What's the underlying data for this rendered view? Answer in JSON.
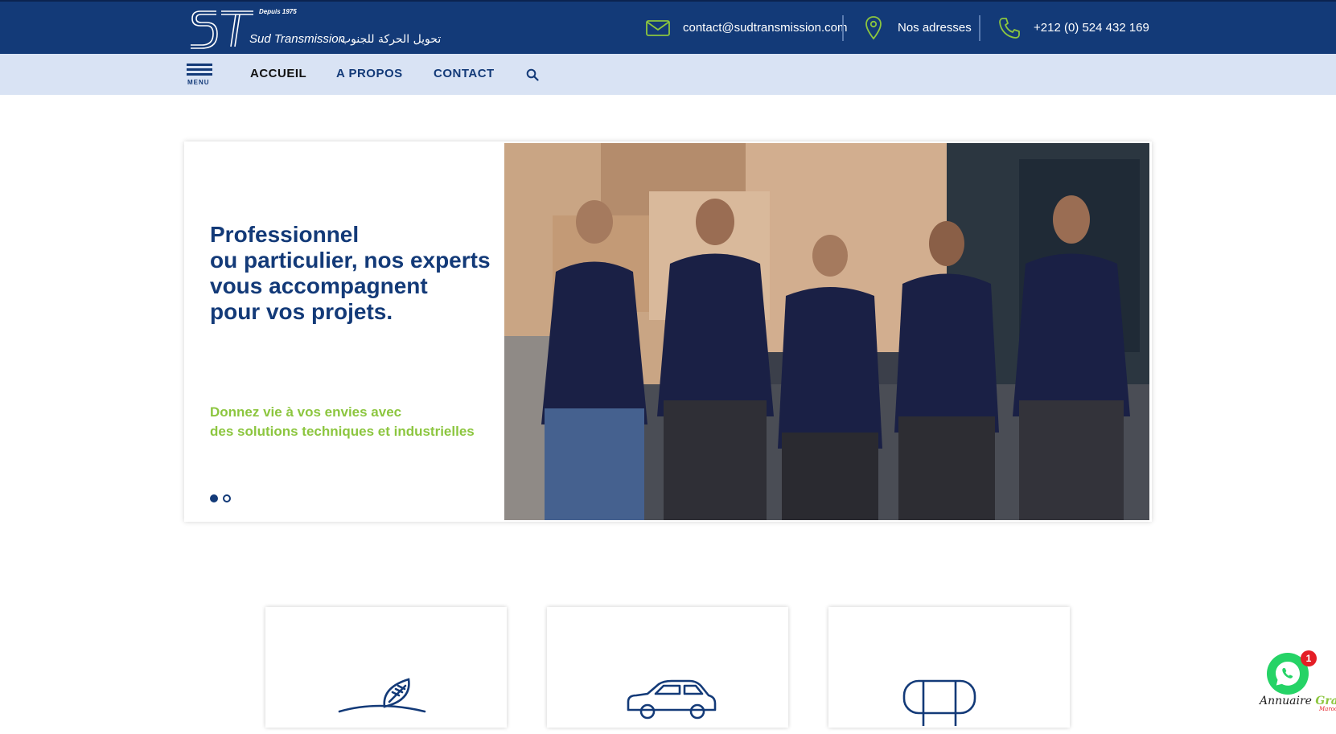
{
  "header": {
    "logo": {
      "since": "Depuis 1975",
      "name": "Sud Transmission",
      "arabic": "تحويل الحركة للجنوب"
    },
    "email": "contact@sudtransmission.com",
    "addresses": "Nos adresses",
    "phone": "+212 (0) 524 432 169"
  },
  "nav": {
    "menu_label": "MENU",
    "items": [
      {
        "label": "ACCUEIL",
        "active": true
      },
      {
        "label": "A PROPOS"
      },
      {
        "label": "CONTACT"
      }
    ],
    "icons": [
      "menu-icon",
      "search-icon"
    ]
  },
  "hero": {
    "title_lines": [
      "Professionnel",
      "ou particulier, nos experts",
      "vous accompagnent",
      "pour vos projets."
    ],
    "subtitle_lines": [
      "Donnez vie à vos envies avec",
      "des solutions techniques et industrielles"
    ],
    "slides": 2,
    "active_slide": 1
  },
  "cards": [
    {
      "icon": "leaf-field-icon"
    },
    {
      "icon": "car-icon"
    },
    {
      "icon": "roller-icon"
    }
  ],
  "whatsapp": {
    "badge": "1"
  },
  "footer_badge": {
    "text_a": "Annuaire",
    "text_b": "Gratuit",
    "text_c": "Maroc"
  },
  "colors": {
    "brand_blue": "#133a78",
    "nav_bg": "#d9e3f4",
    "accent_green": "#8cc63f",
    "whatsapp": "#25d366",
    "badge_red": "#e41e26"
  }
}
